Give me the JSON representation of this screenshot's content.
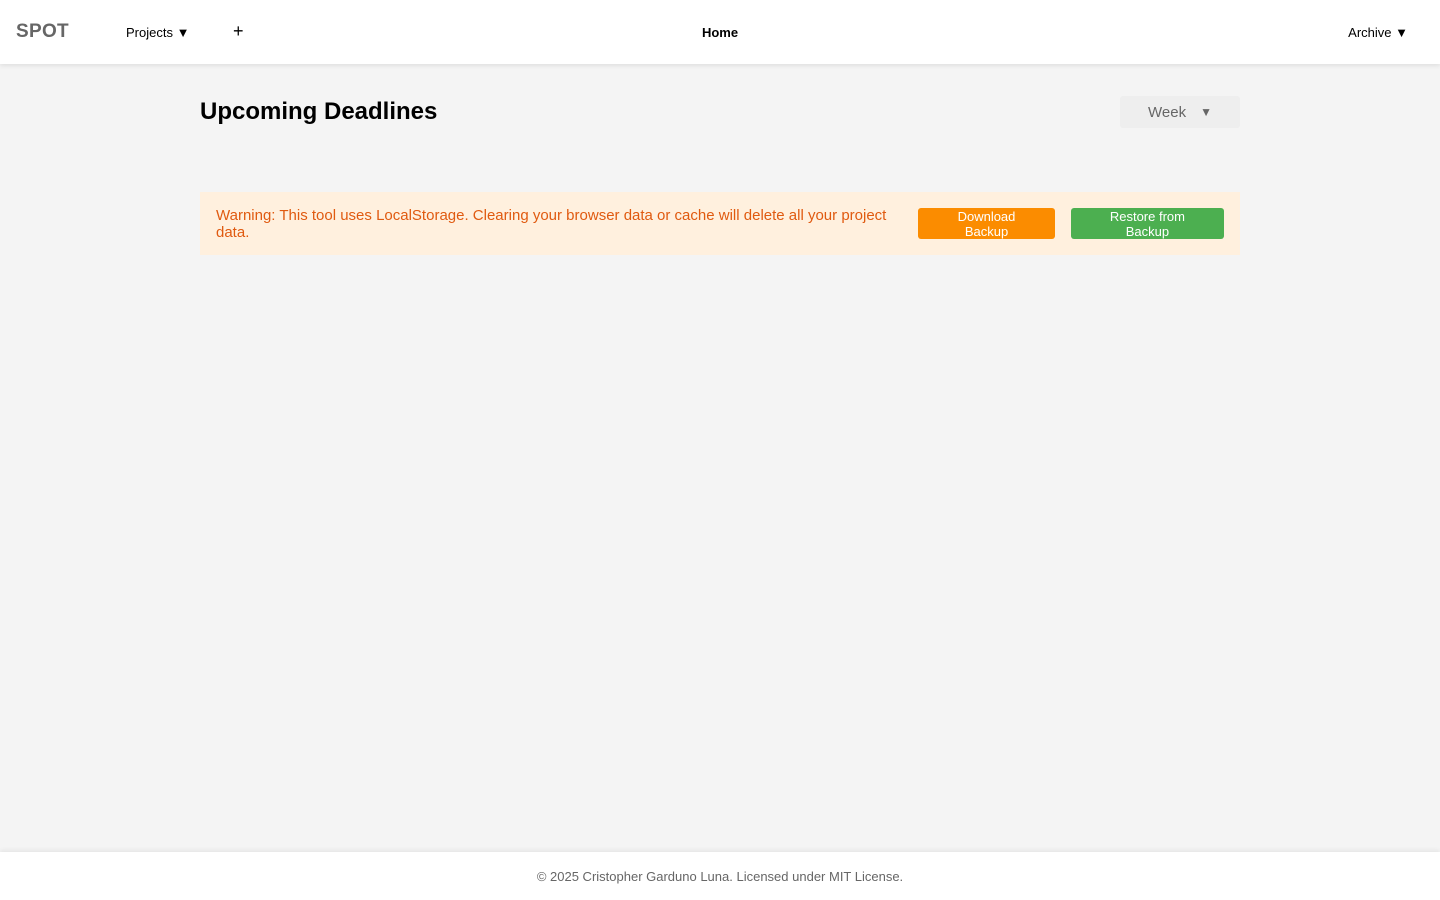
{
  "navbar": {
    "brand": "SPOT",
    "projects_label": "Projects ▼",
    "add_label": "+",
    "home_label": "Home",
    "archive_label": "Archive ▼"
  },
  "main": {
    "title": "Upcoming Deadlines",
    "range_select": {
      "value": "Week",
      "caret": "▼"
    },
    "warning": {
      "text": "Warning: This tool uses LocalStorage. Clearing your browser data or cache will delete all your project data.",
      "download_label": "Download Backup",
      "restore_label": "Restore from Backup"
    }
  },
  "footer": {
    "text": "© 2025 Cristopher Garduno Luna. Licensed under MIT License."
  },
  "colors": {
    "download_button": "#fb8c00",
    "restore_button": "#4caf50",
    "warning_bg": "#fff0de",
    "warning_text": "#e05a10"
  }
}
